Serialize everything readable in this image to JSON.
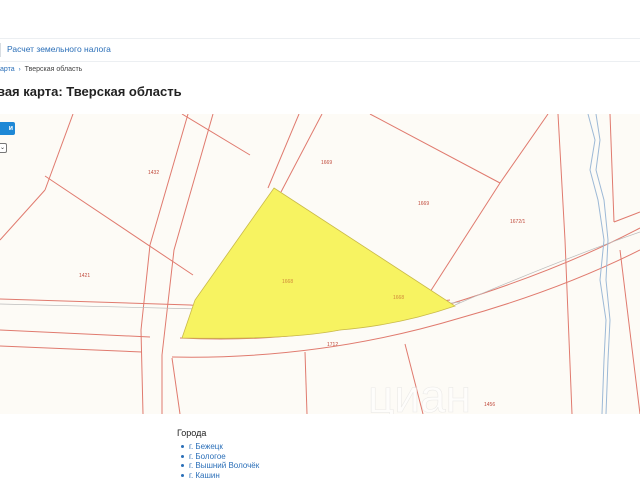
{
  "header": {
    "tax_link": "Расчет земельного налога"
  },
  "breadcrumb": {
    "item1": "арта",
    "item2": "Тверская область"
  },
  "page_title": "вая карта: Тверская область",
  "map": {
    "parcel_labels": [
      {
        "id": "1432",
        "text": "1432"
      },
      {
        "id": "1669a",
        "text": "1669"
      },
      {
        "id": "1669b",
        "text": "1669"
      },
      {
        "id": "1672",
        "text": "1672/1"
      },
      {
        "id": "1421",
        "text": "1421"
      },
      {
        "id": "1668a",
        "text": "1668"
      },
      {
        "id": "1668b",
        "text": "1668"
      },
      {
        "id": "1712",
        "text": "1712"
      },
      {
        "id": "1456",
        "text": "1456"
      }
    ],
    "highlight_color": "#f7f361",
    "boundary_color": "#e07a6e",
    "river_color": "#9db9d6",
    "button_label": "и",
    "watermark": "циан"
  },
  "cities": {
    "title": "Города",
    "items": [
      "г. Бежецк",
      "г. Бологое",
      "г. Вышний Волочёк",
      "г. Кашин"
    ]
  }
}
